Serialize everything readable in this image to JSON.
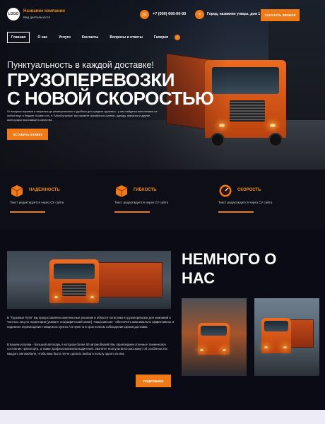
{
  "header": {
    "logo": "LOGO",
    "company_name": "Название компании",
    "activity": "Вид деятельности",
    "phone": "+7 (000) 000-00-00",
    "address": "Город, название улицы, дом 1",
    "call_button": "ЗАКАЗАТЬ ЗВОНОК"
  },
  "nav": {
    "items": [
      "Главная",
      "О нас",
      "Услуги",
      "Контакты",
      "Вопросы и ответы",
      "Галерея"
    ],
    "more": "+"
  },
  "hero": {
    "kicker": "Пунктуальность в каждой доставке!",
    "headline_line1": "ГРУЗОПЕРЕВОЗКИ",
    "headline_line2": "С НОВОЙ СКОРОСТЬЮ",
    "lead": "От мощных взрывов и свирепых до универсальных и удобных для средних грузовых - у нас найдется автотехника на любой вкус и бюджет. Кроме того, в \"MotoDynamics\" вы сможете приобрести шлемы, одежду, перчатки и другие аксессуары высочайшего качества.",
    "cta": "ОСТАВИТЬ ЗАЯВКУ"
  },
  "features": [
    {
      "title": "НАДЕЖНОСТЬ",
      "text": "Текст редактируется через СУ сайта",
      "icon": "box-icon"
    },
    {
      "title": "ГИБКОСТЬ",
      "text": "Текст редактируется через СУ сайта",
      "icon": "box-icon"
    },
    {
      "title": "СКОРОСТЬ",
      "text": "Текст редактируется через СУ сайта",
      "icon": "speedometer-icon"
    }
  ],
  "about": {
    "title_line1": "НЕМНОГО О",
    "title_line2": "НАС",
    "p1": "В \"Грузовые Пути\" мы предоставляем комплексные решения в области логистики и грузоперевозок для компаний и частных лиц на территории [укажите географический охват]. Наша миссия - обеспечить максимально эффективное и надежное перемещение товаров из пункта А в пункт Б в срок полном соблюдении сроков доставки.",
    "p2": "В вашем услугам - большой автопарк, в котором более 50 автомобилей! Мы гарантируем отличное техническое состояние транспорта, а также профессионализм водителей. Звоните! Консультанты расскажут об особенностях каждого автомобиля, чтобы вам было легче сделать выбор в пользу одного из них.",
    "more": "ПОДРОБНЕЕ"
  },
  "colors": {
    "accent": "#f07a18",
    "background": "#0c0c14"
  }
}
